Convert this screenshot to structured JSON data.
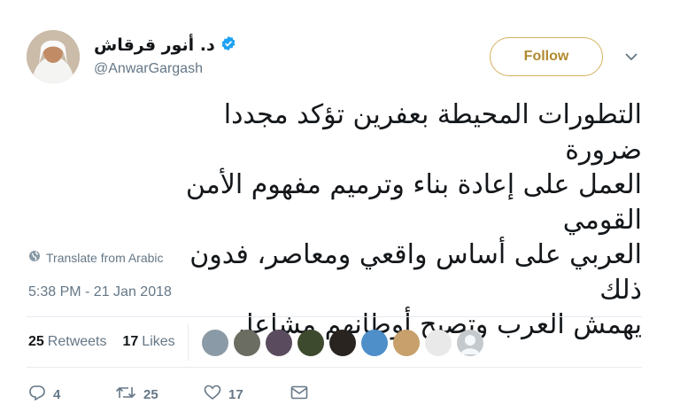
{
  "user": {
    "display_name": "د. أنور قرقاش",
    "handle": "@AnwarGargash",
    "verified": true
  },
  "follow_button": {
    "label": "Follow",
    "color": "#b08a2e"
  },
  "tweet": {
    "text_lines": [
      "التطورات المحيطة بعفرين تؤكد مجددا ضرورة",
      "العمل على إعادة بناء وترميم مفهوم الأمن القومي",
      "العربي على أساس واقعي ومعاصر، فدون ذلك",
      "يهمش العرب وتصبح أوطانهم مشاعا."
    ],
    "translate_label": "Translate from Arabic",
    "timestamp": "5:38 PM - 21 Jan 2018"
  },
  "stats": {
    "retweets_count": "25",
    "retweets_label": "Retweets",
    "likes_count": "17",
    "likes_label": "Likes"
  },
  "likers": [
    {
      "icon": "avatar",
      "color": "#8a9aa6"
    },
    {
      "icon": "avatar",
      "color": "#6b6d62"
    },
    {
      "icon": "avatar",
      "color": "#5a4b5e"
    },
    {
      "icon": "avatar",
      "color": "#3d4a2e"
    },
    {
      "icon": "avatar",
      "color": "#2a2420"
    },
    {
      "icon": "avatar",
      "color": "#4e8ec9"
    },
    {
      "icon": "avatar",
      "color": "#c7a06c"
    },
    {
      "icon": "avatar",
      "color": "#e9e9e9"
    },
    {
      "icon": "avatar",
      "color": "#c4c9cd"
    }
  ],
  "actions": {
    "reply_count": "4",
    "retweet_count": "25",
    "like_count": "17"
  },
  "colors": {
    "secondary_text": "#657786",
    "verified": "#1da1f2",
    "divider": "#e6ecf0"
  }
}
